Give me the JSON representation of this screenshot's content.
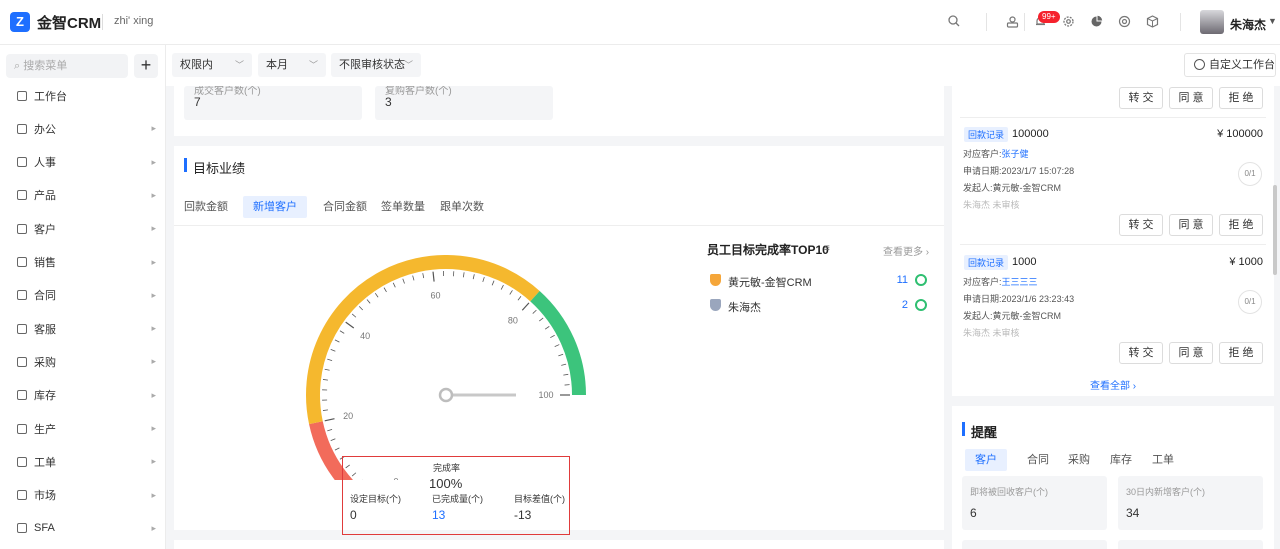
{
  "header": {
    "logo_letter": "Z",
    "app_title": "金智CRM",
    "tenant": "zhi' xing",
    "notification_badge": "99+",
    "user_name": "朱海杰"
  },
  "sidebar": {
    "search_placeholder": "搜索菜单",
    "add_label": "+",
    "items": [
      {
        "label": "工作台",
        "has_arrow": false
      },
      {
        "label": "办公",
        "has_arrow": true
      },
      {
        "label": "人事",
        "has_arrow": true
      },
      {
        "label": "产品",
        "has_arrow": true
      },
      {
        "label": "客户",
        "has_arrow": true
      },
      {
        "label": "销售",
        "has_arrow": true
      },
      {
        "label": "合同",
        "has_arrow": true
      },
      {
        "label": "客服",
        "has_arrow": true
      },
      {
        "label": "采购",
        "has_arrow": true
      },
      {
        "label": "库存",
        "has_arrow": true
      },
      {
        "label": "生产",
        "has_arrow": true
      },
      {
        "label": "工单",
        "has_arrow": true
      },
      {
        "label": "市场",
        "has_arrow": true
      },
      {
        "label": "SFA",
        "has_arrow": true
      }
    ]
  },
  "filters": {
    "scope": "权限内",
    "period": "本月",
    "audit": "不限审核状态",
    "custom_workspace": "自定义工作台"
  },
  "top_stats": [
    {
      "label": "成交客户数(个)",
      "value": "7"
    },
    {
      "label": "复购客户数(个)",
      "value": "3"
    }
  ],
  "target": {
    "title": "目标业绩",
    "tabs": [
      "回款金额",
      "新增客户",
      "合同金额",
      "签单数量",
      "跟单次数"
    ],
    "active_tab": 1,
    "gauge": {
      "ticks": [
        "0",
        "20",
        "40",
        "60",
        "80",
        "100"
      ],
      "needle_value": 100,
      "center_label": "完成率",
      "rate": "100%",
      "metrics": [
        {
          "label": "设定目标(个)",
          "value": "0",
          "color": "#333333"
        },
        {
          "label": "已完成量(个)",
          "value": "13",
          "color": "#1e6fff"
        },
        {
          "label": "目标差值(个)",
          "value": "-13",
          "color": "#333333"
        }
      ]
    },
    "ranking": {
      "title": "员工目标完成率TOP10",
      "see_more": "查看更多",
      "rows": [
        {
          "name": "黄元敏-金智CRM",
          "value": "11",
          "medal": "gold"
        },
        {
          "name": "朱海杰",
          "value": "2",
          "medal": "silver"
        }
      ]
    }
  },
  "approvals": {
    "buttons": [
      "转 交",
      "同 意",
      "拒 绝"
    ],
    "records": [
      {
        "tag": "回款记录",
        "amount": "100000",
        "amount_right": "¥ 100000",
        "customer_label": "对应客户:",
        "customer": "张子健",
        "date_label": "申请日期:",
        "date": "2023/1/7 15:07:28",
        "sender_label": "发起人:",
        "sender": "黄元敏-金智CRM",
        "status": "朱海杰 未审核",
        "progress": "0/1"
      },
      {
        "tag": "回款记录",
        "amount": "1000",
        "amount_right": "¥ 1000",
        "customer_label": "对应客户:",
        "customer": "王三三三",
        "date_label": "申请日期:",
        "date": "2023/1/6 23:23:43",
        "sender_label": "发起人:",
        "sender": "黄元敏-金智CRM",
        "status": "朱海杰 未审核",
        "progress": "0/1"
      }
    ],
    "view_all": "查看全部"
  },
  "reminder": {
    "title": "提醒",
    "tabs": [
      "客户",
      "合同",
      "采购",
      "库存",
      "工单"
    ],
    "active_tab": 0,
    "cards": [
      {
        "label": "即将被回收客户(个)",
        "value": "6"
      },
      {
        "label": "30日内新增客户(个)",
        "value": "34"
      }
    ]
  },
  "colors": {
    "accent": "#1e6fff",
    "gauge_red": "#f26b5b",
    "gauge_yellow": "#f5b82e",
    "gauge_green": "#3cc47c",
    "highlight_box": "#e03b3b"
  }
}
